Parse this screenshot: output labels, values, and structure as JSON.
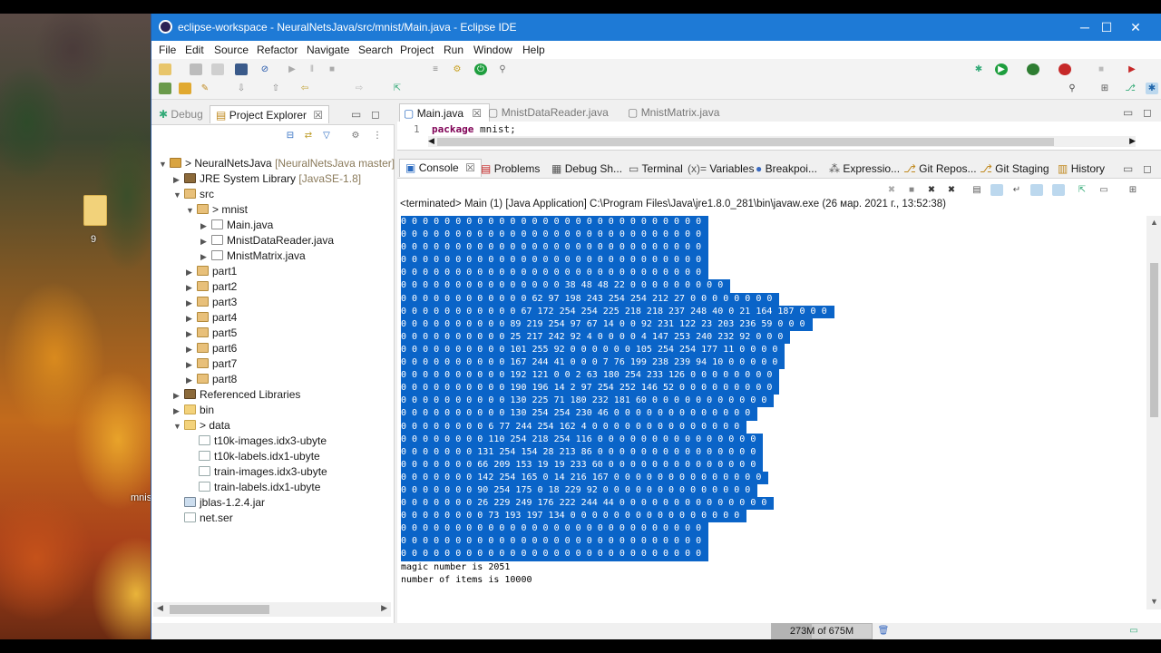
{
  "desktop": {
    "folder_label": "9",
    "file_label": "mnis"
  },
  "window": {
    "title": "eclipse-workspace - NeuralNetsJava/src/mnist/Main.java - Eclipse IDE",
    "controls": {
      "minimize": "─",
      "maximize": "☐",
      "close": "✕"
    }
  },
  "menu": [
    "File",
    "Edit",
    "Source",
    "Refactor",
    "Navigate",
    "Search",
    "Project",
    "Run",
    "Window",
    "Help"
  ],
  "explorer": {
    "tabs": {
      "debug": "Debug",
      "project_explorer": "Project Explorer",
      "close": "☒"
    },
    "tree": [
      {
        "label": "> NeuralNetsJava",
        "decoration": "[NeuralNetsJava master]",
        "icon": "project-icon"
      },
      {
        "label": "JRE System Library",
        "decoration": "[JavaSE-1.8]",
        "icon": "library-icon"
      },
      {
        "label": "src",
        "icon": "source-folder-icon"
      },
      {
        "label": "> mnist",
        "icon": "package-icon"
      },
      {
        "label": "Main.java",
        "icon": "java-file-icon"
      },
      {
        "label": "MnistDataReader.java",
        "icon": "java-file-icon"
      },
      {
        "label": "MnistMatrix.java",
        "icon": "java-file-icon"
      },
      {
        "label": "part1",
        "icon": "package-icon"
      },
      {
        "label": "part2",
        "icon": "package-icon"
      },
      {
        "label": "part3",
        "icon": "package-icon"
      },
      {
        "label": "part4",
        "icon": "package-icon"
      },
      {
        "label": "part5",
        "icon": "package-icon"
      },
      {
        "label": "part6",
        "icon": "package-icon"
      },
      {
        "label": "part7",
        "icon": "package-icon"
      },
      {
        "label": "part8",
        "icon": "package-icon"
      },
      {
        "label": "Referenced Libraries",
        "icon": "library-icon"
      },
      {
        "label": "bin",
        "icon": "folder-icon"
      },
      {
        "label": "> data",
        "icon": "folder-icon"
      },
      {
        "label": "t10k-images.idx3-ubyte",
        "icon": "file-icon"
      },
      {
        "label": "t10k-labels.idx1-ubyte",
        "icon": "file-icon"
      },
      {
        "label": "train-images.idx3-ubyte",
        "icon": "file-icon"
      },
      {
        "label": "train-labels.idx1-ubyte",
        "icon": "file-icon"
      },
      {
        "label": "jblas-1.2.4.jar",
        "icon": "jar-icon"
      },
      {
        "label": "net.ser",
        "icon": "file-icon"
      }
    ]
  },
  "editor": {
    "tabs": [
      "Main.java",
      "MnistDataReader.java",
      "MnistMatrix.java"
    ],
    "line_number": "1",
    "keyword": "package",
    "code_rest": " mnist;"
  },
  "console": {
    "tabs": [
      "Console",
      "Problems",
      "Debug Sh...",
      "Terminal",
      "Variables",
      "Breakpoi...",
      "Expressio...",
      "Git Repos...",
      "Git Staging",
      "History"
    ],
    "status": "<terminated> Main (1) [Java Application] C:\\Program Files\\Java\\jre1.8.0_281\\bin\\javaw.exe (26 мар. 2021 г., 13:52:38)",
    "selected_lines": [
      "0 0 0 0 0 0 0 0 0 0 0 0 0 0 0 0 0 0 0 0 0 0 0 0 0 0 0 0",
      "0 0 0 0 0 0 0 0 0 0 0 0 0 0 0 0 0 0 0 0 0 0 0 0 0 0 0 0",
      "0 0 0 0 0 0 0 0 0 0 0 0 0 0 0 0 0 0 0 0 0 0 0 0 0 0 0 0",
      "0 0 0 0 0 0 0 0 0 0 0 0 0 0 0 0 0 0 0 0 0 0 0 0 0 0 0 0",
      "0 0 0 0 0 0 0 0 0 0 0 0 0 0 0 0 0 0 0 0 0 0 0 0 0 0 0 0",
      "0 0 0 0 0 0 0 0 0 0 0 0 0 0 0 38 48 48 22 0 0 0 0 0 0 0 0 0",
      "0 0 0 0 0 0 0 0 0 0 0 0 62 97 198 243 254 254 212 27 0 0 0 0 0 0 0 0",
      "0 0 0 0 0 0 0 0 0 0 0 67 172 254 254 225 218 218 237 248 40 0 21 164 187 0 0 0",
      "0 0 0 0 0 0 0 0 0 0 89 219 254 97 67 14 0 0 92 231 122 23 203 236 59 0 0 0",
      "0 0 0 0 0 0 0 0 0 0 25 217 242 92 4 0 0 0 0 4 147 253 240 232 92 0 0 0",
      "0 0 0 0 0 0 0 0 0 0 101 255 92 0 0 0 0 0 0 105 254 254 177 11 0 0 0 0",
      "0 0 0 0 0 0 0 0 0 0 167 244 41 0 0 0 7 76 199 238 239 94 10 0 0 0 0 0",
      "0 0 0 0 0 0 0 0 0 0 192 121 0 0 2 63 180 254 233 126 0 0 0 0 0 0 0 0",
      "0 0 0 0 0 0 0 0 0 0 190 196 14 2 97 254 252 146 52 0 0 0 0 0 0 0 0 0",
      "0 0 0 0 0 0 0 0 0 0 130 225 71 180 232 181 60 0 0 0 0 0 0 0 0 0 0 0",
      "0 0 0 0 0 0 0 0 0 0 130 254 254 230 46 0 0 0 0 0 0 0 0 0 0 0 0 0",
      "0 0 0 0 0 0 0 0 6 77 244 254 162 4 0 0 0 0 0 0 0 0 0 0 0 0 0 0",
      "0 0 0 0 0 0 0 0 110 254 218 254 116 0 0 0 0 0 0 0 0 0 0 0 0 0 0 0",
      "0 0 0 0 0 0 0 131 254 154 28 213 86 0 0 0 0 0 0 0 0 0 0 0 0 0 0 0",
      "0 0 0 0 0 0 0 66 209 153 19 19 233 60 0 0 0 0 0 0 0 0 0 0 0 0 0 0",
      "0 0 0 0 0 0 0 142 254 165 0 14 216 167 0 0 0 0 0 0 0 0 0 0 0 0 0 0",
      "0 0 0 0 0 0 0 90 254 175 0 18 229 92 0 0 0 0 0 0 0 0 0 0 0 0 0 0",
      "0 0 0 0 0 0 0 26 229 249 176 222 244 44 0 0 0 0 0 0 0 0 0 0 0 0 0 0",
      "0 0 0 0 0 0 0 0 73 193 197 134 0 0 0 0 0 0 0 0 0 0 0 0 0 0 0 0",
      "0 0 0 0 0 0 0 0 0 0 0 0 0 0 0 0 0 0 0 0 0 0 0 0 0 0 0 0",
      "0 0 0 0 0 0 0 0 0 0 0 0 0 0 0 0 0 0 0 0 0 0 0 0 0 0 0 0",
      "0 0 0 0 0 0 0 0 0 0 0 0 0 0 0 0 0 0 0 0 0 0 0 0 0 0 0 0"
    ],
    "plain_lines": [
      "magic number is 2051",
      "number of items is 10000"
    ]
  },
  "status": {
    "heap": "273M of 675M",
    "heap_used_fraction": 0.404
  }
}
